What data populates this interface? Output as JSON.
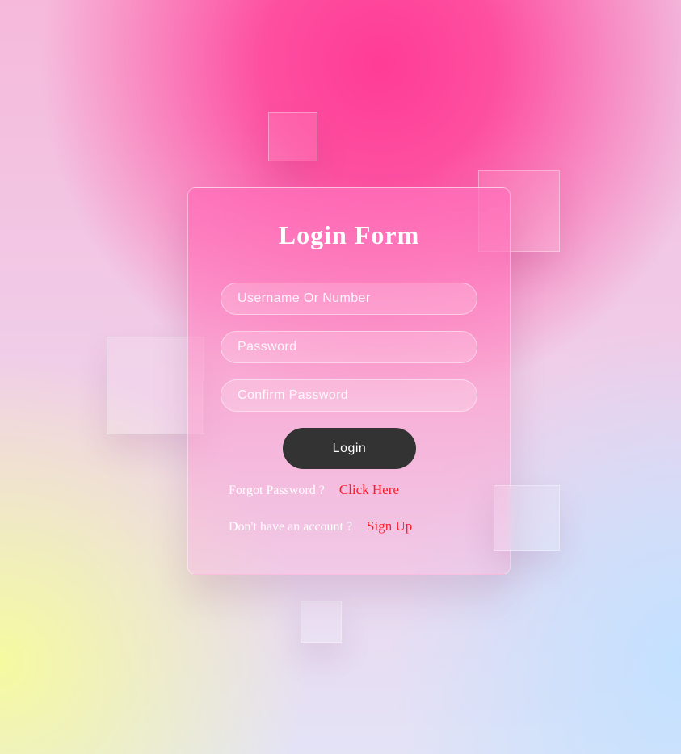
{
  "form": {
    "title": "Login Form",
    "fields": [
      {
        "placeholder": "Username Or Number",
        "value": ""
      },
      {
        "placeholder": "Password",
        "value": ""
      },
      {
        "placeholder": "Confirm Password",
        "value": ""
      }
    ],
    "login_label": "Login",
    "forgot_text": "Forgot Password ?",
    "forgot_link": "Click Here",
    "signup_text": "Don't have an account ?",
    "signup_link": "Sign Up"
  },
  "colors": {
    "button_bg": "#333333",
    "link": "#ff1a2a",
    "accent_pink": "#ff3c96"
  }
}
